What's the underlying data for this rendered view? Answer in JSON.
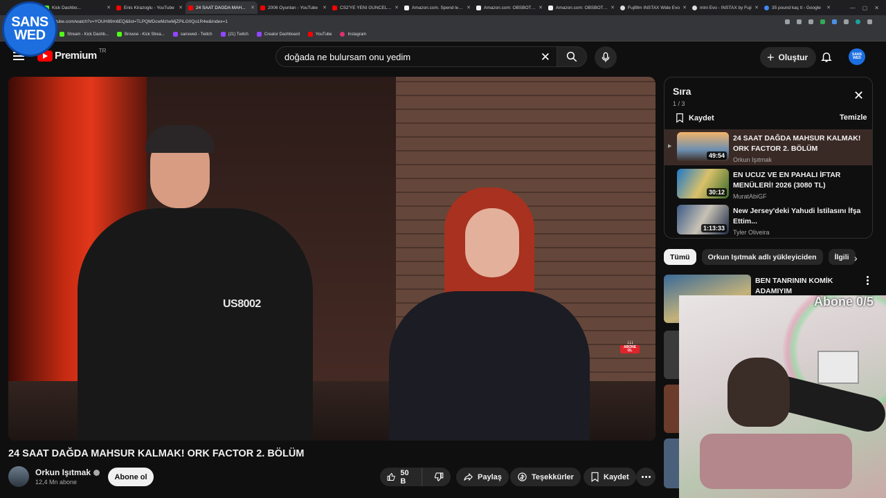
{
  "browser": {
    "tabs": [
      {
        "title": "Kick Dashbo...",
        "icon": "kick-favicon"
      },
      {
        "title": "Enis Kirazoglu - YouTube",
        "icon": "youtube-favicon"
      },
      {
        "title": "24 SAAT DAĞDA MAH...",
        "icon": "youtube-favicon",
        "active": true
      },
      {
        "title": "2006 Oyunları - YouTube",
        "icon": "youtube-favicon"
      },
      {
        "title": "CS2'YE YENİ GÜNCELLEME...",
        "icon": "youtube-favicon"
      },
      {
        "title": "Amazon.com. Spend less...",
        "icon": "amazon-favicon"
      },
      {
        "title": "Amazon.com: OBSBOT M...",
        "icon": "amazon-favicon"
      },
      {
        "title": "Amazon.com: OBSBOT Ti...",
        "icon": "amazon-favicon"
      },
      {
        "title": "Fujifilm INSTAX Wide Evo",
        "icon": "fujifilm-favicon"
      },
      {
        "title": "mini Evo - INSTAX by Fuji",
        "icon": "fujifilm-favicon"
      },
      {
        "title": "35 pound kaç tl - Google",
        "icon": "google-favicon"
      }
    ],
    "url": "youtube.com/watch?v=YOUH89m6EQ&list=TLPQMDcwMzIwMjZPiLG0Qo1R4w&index=1",
    "bookmarks": [
      "Stream - Kick Dashb...",
      "Browse - Kick Strea...",
      "sanswed - Twitch",
      "(21) Twitch",
      "Creator Dashboard",
      "YouTube",
      "Instagram"
    ]
  },
  "overlay": {
    "logo_line1": "SANS",
    "logo_line2": "WED",
    "abone_counter": "Abone 0/5"
  },
  "header": {
    "logo_text": "Premium",
    "country_code": "TR",
    "search_value": "doğada ne bulursam onu yedim",
    "create_label": "Oluştur",
    "avatar_text": "SANS WED"
  },
  "player": {
    "shirt_text": "US8002",
    "sticker_label": "ABONE OL",
    "sticker_arrows": "↓↓↓"
  },
  "video": {
    "title": "24 SAAT DAĞDA MAHSUR KALMAK! ORK FACTOR 2. BÖLÜM",
    "channel": "Orkun Işıtmak",
    "subscribers": "12,4 Mn abone",
    "subscribe_label": "Abone ol",
    "likes": "50 B",
    "share_label": "Paylaş",
    "thanks_label": "Teşekkürler",
    "save_label": "Kaydet"
  },
  "queue": {
    "title": "Sıra",
    "position": "1 / 3",
    "save_label": "Kaydet",
    "clear_label": "Temizle",
    "items": [
      {
        "title": "24 SAAT DAĞDA MAHSUR KALMAK! ORK FACTOR 2. BÖLÜM",
        "channel": "Orkun Işıtmak",
        "duration": "49:54",
        "current": true
      },
      {
        "title": "EN UCUZ VE EN PAHALI İFTAR MENÜLERİ! 2026 (3080 TL)",
        "channel": "MuratAbiGF",
        "duration": "30:12",
        "current": false
      },
      {
        "title": "New Jersey'deki Yahudi İstilasını İfşa Ettim...",
        "channel": "Tyler Oliveira",
        "duration": "1:13:33",
        "current": false
      }
    ]
  },
  "chips": [
    "Tümü",
    "Orkun Işıtmak adlı yükleyiciden",
    "İlgili"
  ],
  "recommendations": [
    {
      "title": "BEN TANRININ KOMİK ADAMIYIM"
    }
  ],
  "colors": {
    "accent": "#ff0000",
    "background": "#0f0f0f",
    "badge_blue": "#1d6fe0"
  }
}
